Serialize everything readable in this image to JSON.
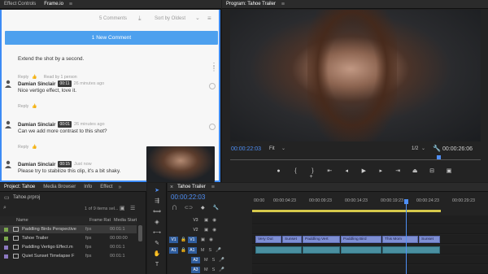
{
  "left_panel": {
    "tabs": [
      {
        "label": "Effect Controls"
      },
      {
        "label": "Frame.io"
      }
    ]
  },
  "frameio": {
    "comment_count": "5 Comments",
    "sort_label": "Sort by Oldest",
    "new_comment_label": "1 New Comment",
    "comments": [
      {
        "author": "",
        "timecode": "",
        "age": "",
        "text": "Extend the shot by a second.",
        "reply": "Reply",
        "read_by": "Read by 1 person"
      },
      {
        "author": "Damian Sinclair",
        "timecode": "00:11",
        "age": "26 minutes ago",
        "text": "Nice vertigo effect, love it.",
        "reply": "Reply"
      },
      {
        "author": "Damian Sinclair",
        "timecode": "00:01",
        "age": "26 minutes ago",
        "text": "Can we add more contrast to this shot?",
        "reply": "Reply"
      },
      {
        "author": "Damian Sinclair",
        "timecode": "00:15",
        "age": "Just now",
        "text": "Please try to stabilize this clip, it's a bit shaky.",
        "reply": "Reply"
      }
    ]
  },
  "program": {
    "title": "Program: Tahoe Trailer",
    "timecode_current": "00:00:22:03",
    "fit_label": "Fit",
    "resolution": "1/2",
    "timecode_total": "00:00:26:06",
    "playhead_fraction": 0.83
  },
  "project": {
    "tabs": [
      {
        "label": "Project: Tahoe"
      },
      {
        "label": "Media Browser"
      },
      {
        "label": "Info"
      },
      {
        "label": "Effect"
      }
    ],
    "file_name": "Tahoe.prproj",
    "count_label": "1 of 9 items sel...",
    "columns": {
      "name": "Name",
      "rate": "Frame Rate",
      "start": "Media Start"
    },
    "rows": [
      {
        "name": "Paddling Birds Perspective",
        "rate": "fps",
        "start": "00:01:1",
        "color": "#7aa64d"
      },
      {
        "name": "Tahoe Trailer",
        "rate": "fps",
        "start": "00:00:00",
        "color": "#7aa64d"
      },
      {
        "name": "Paddling Vertigo Effect.m",
        "rate": "fps",
        "start": "00:01:1",
        "color": "#8c78c0"
      },
      {
        "name": "Quiet Sunset Timelapse F",
        "rate": "fps",
        "start": "00:01:1",
        "color": "#8c78c0"
      }
    ]
  },
  "timeline": {
    "title": "Tahoe Trailer",
    "timecode": "00:00:22:03",
    "ruler_ticks": [
      "00:00",
      "00:00:04:23",
      "00:00:09:23",
      "00:00:14:23",
      "00:00:19:23",
      "00:00:24:23",
      "00:00:29:23"
    ],
    "video_tracks": [
      "V3",
      "V2",
      "V1"
    ],
    "audio_tracks": [
      "A1",
      "A2",
      "A3"
    ],
    "clips": [
      "Very Out",
      "Sunset",
      "Paddling Vert",
      "Paddling Bird",
      "This Mom",
      "Sunset"
    ]
  },
  "colors": {
    "accent": "#4f8ff5",
    "frameio_blue": "#4da0ee",
    "video_clip": "#7e8fd4",
    "audio_clip": "#4a8fa0",
    "work_area": "#d6c94b"
  }
}
